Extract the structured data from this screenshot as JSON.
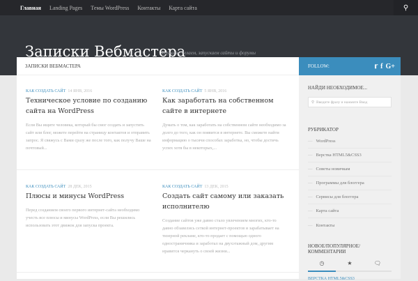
{
  "nav": {
    "items": [
      "Главная",
      "Landing Pages",
      "Темы WordPress",
      "Контакты",
      "Карта сайта"
    ]
  },
  "header": {
    "title": "Записки Вебмастера",
    "tagline": "Изучаем, делаем, запускаем сайты и форумы"
  },
  "main": {
    "heading": "ЗАПИСКИ ВЕБМАСТЕРА",
    "posts": [
      {
        "category": "КАК СОЗДАТЬ САЙТ",
        "date": "14 ЯНВ, 2016",
        "title": "Техническое условие по созданию сайта на WordPress",
        "excerpt": "Если Вы ищите человека, который бы смог создать и запустить сайт или блог, можете перейти на страницу контактов и отправить запрос. Я свяжусь с Вами сразу же после того, как получу Ваше на почтовый..."
      },
      {
        "category": "КАК СОЗДАТЬ САЙТ",
        "date": "5 ЯНВ, 2016",
        "title": "Как заработать на собственном сайте в интернете",
        "excerpt": "Думать о том, как заработать на собственном сайте необходимо за долго до того, как он появится в интернете. Вы сможете найти информацию о тысячи способах заработка, но, чтобы достичь успех хотя бы в некоторых,..."
      },
      {
        "category": "КАК СОЗДАТЬ САЙТ",
        "date": "28 ДЕК, 2015",
        "title": "Плюсы и минусы WordPress",
        "excerpt": "Перед созданием своего первого интернет-сайта необходимо учесть все плюсы и минусы WordPress, если Вы решились использовать этот движок для запуска проекта."
      },
      {
        "category": "КАК СОЗДАТЬ САЙТ",
        "date": "13 ДЕК, 2015",
        "title": "Создать сайт самому или заказать исполнителю",
        "excerpt": "Создание сайтов уже давно стало увлечением многих, кто-то давно обзавелись сеткой интернет-проектов и зарабатывает на тизерной рекламе, кто-то продает с помощью одного одностраничника и заработал на двухэтажный дом, другим нравится черкануть о своей жизни..."
      }
    ]
  },
  "sidebar": {
    "follow": "FOLLOW:",
    "search_title": "НАЙДИ НЕОБХОДИМОЕ...",
    "search_placeholder": "Введите фразу и нажмите Ввод",
    "categories_title": "РУБРИКАТОР",
    "categories": [
      "WordPress",
      "Верстка HTML5&CSS3",
      "Советы новичкам",
      "Программы для блоггера",
      "Сервисы для блоггера",
      "Карта сайта",
      "Контакты"
    ],
    "tabs_title": "НОВОЕ/ПОПУЛЯРНОЕ/КОММЕНТАРИИ",
    "first_item": "ВЕРСТКА HTML5&CSS3"
  }
}
